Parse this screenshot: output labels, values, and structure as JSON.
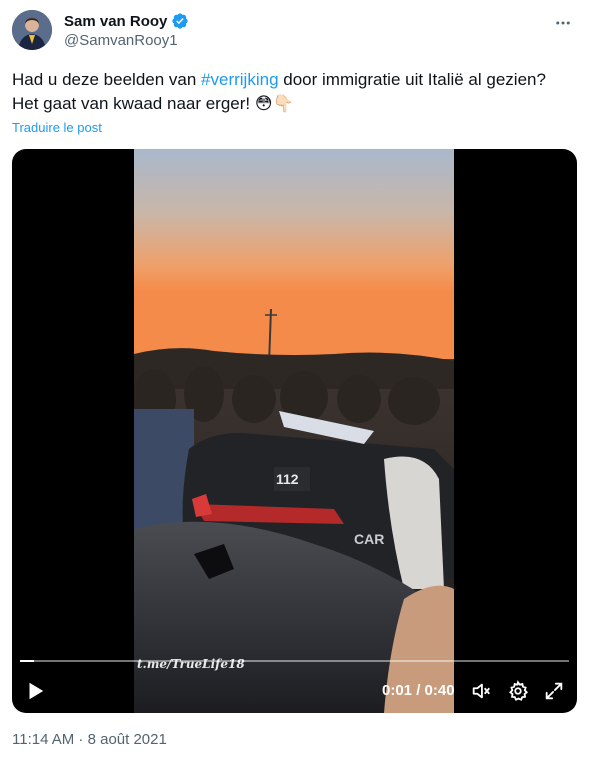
{
  "author": {
    "display_name": "Sam van Rooy",
    "handle": "@SamvanRooy1",
    "verified_icon": "verified-badge-icon",
    "avatar_icon": "avatar"
  },
  "tweet": {
    "text_before": "Had u deze beelden van ",
    "hashtag": "#verrijking",
    "text_after": " door immigratie uit Italië al gezien? Het gaat van kwaad naar erger! ",
    "emojis": "😳👇🏻",
    "translate_label": "Traduire le post",
    "timestamp": "11:14 AM · 8 août 2021"
  },
  "video": {
    "watermark": "t.me/TrueLife18",
    "current_time": "0:01",
    "separator": " / ",
    "duration": "0:40",
    "progress_fraction": 0.025,
    "car_number": "112",
    "car_text": "CAR"
  },
  "colors": {
    "accent": "#1d9bf0",
    "text_primary": "#0f1419",
    "text_secondary": "#536471"
  }
}
